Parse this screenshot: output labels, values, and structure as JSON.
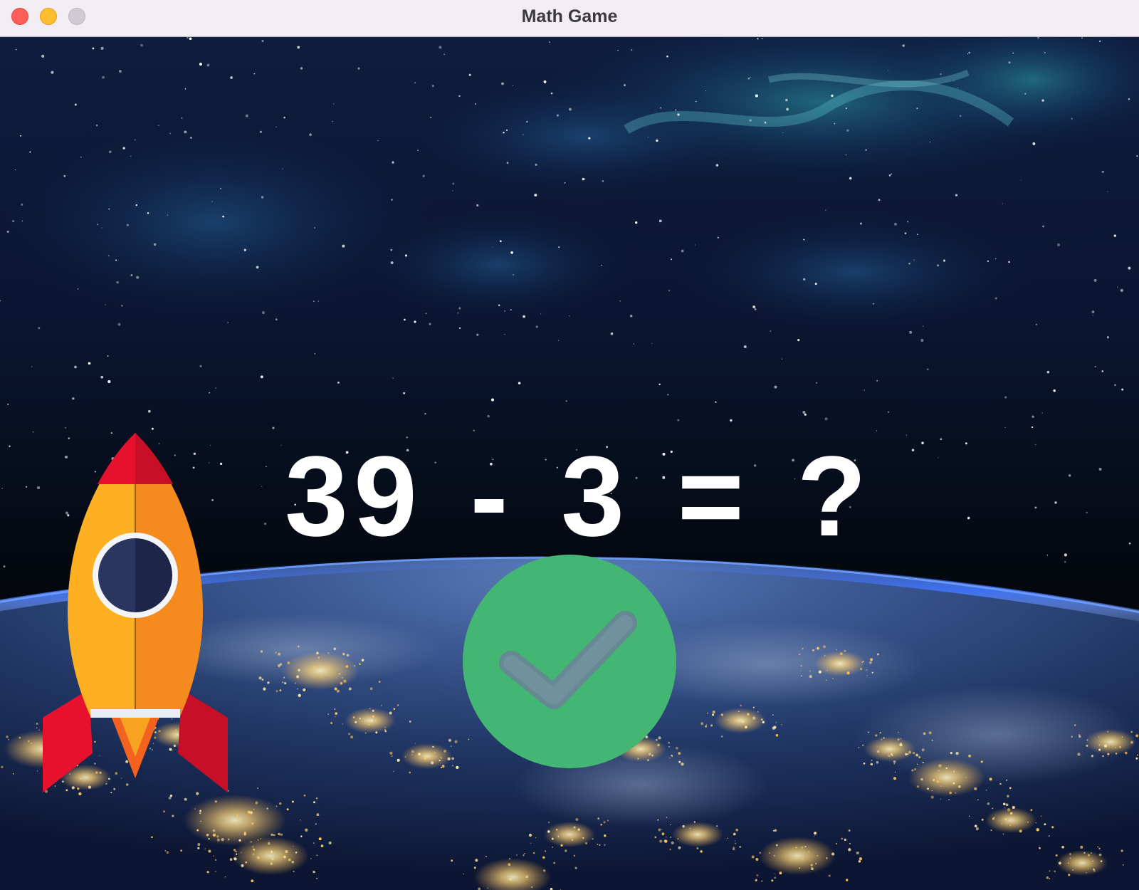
{
  "window": {
    "title": "Math Game"
  },
  "game": {
    "question": "39 - 3 = ?"
  },
  "icons": {
    "close": "window-close-icon",
    "minimize": "window-minimize-icon",
    "zoom": "window-zoom-icon",
    "submit": "checkmark-icon",
    "player": "rocket-icon"
  },
  "colors": {
    "check_green": "#43b673",
    "rocket_body_light": "#fdb022",
    "rocket_body_dark": "#f58a1f",
    "rocket_red": "#e8112d",
    "window_navy": "#1f2a4f",
    "space_dark": "#050a1a"
  }
}
